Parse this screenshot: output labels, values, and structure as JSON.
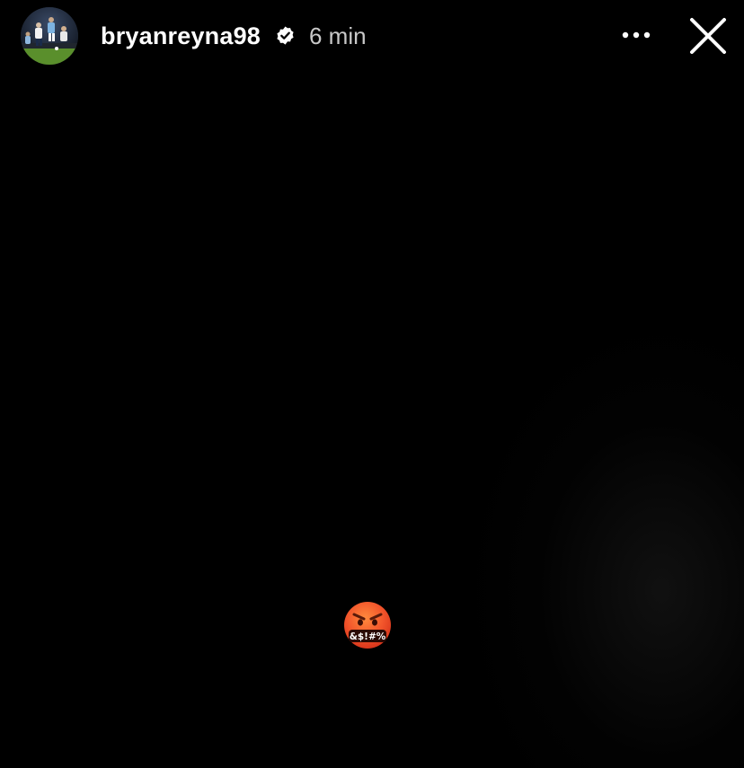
{
  "story": {
    "author": {
      "username": "bryanreyna98",
      "verified_icon": "verified-badge-icon",
      "avatar_icon": "profile-photo"
    },
    "posted_ago": "6 min",
    "controls": {
      "more_icon": "more-horizontal-icon",
      "close_icon": "close-icon"
    },
    "sticker": {
      "icon": "face-with-symbols-on-mouth-emoji",
      "text": "&$!#%"
    }
  },
  "colors": {
    "background": "#000000",
    "text_primary": "#ffffff",
    "text_secondary": "#c8c8c8",
    "emoji_face": "#f2552b"
  }
}
